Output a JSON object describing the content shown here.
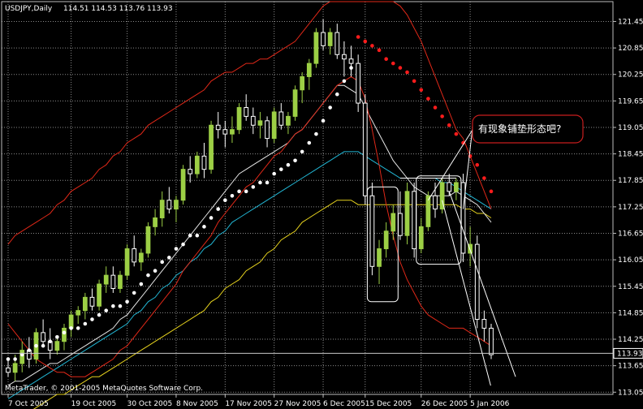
{
  "chart_data": {
    "type": "candlestick",
    "header": "USDJPY,Daily",
    "ohlc_text": "114.51 114.53 113.76 113.93",
    "current_price_label": "113.93",
    "copyright": "MetaTrader, © 2001-2005 MetaQuotes Software Corp.",
    "annotation": "有现象铺垫形态吧?",
    "ylim": [
      113.0,
      121.9
    ],
    "y_ticks": [
      "121.45",
      "120.85",
      "120.25",
      "119.65",
      "119.05",
      "118.45",
      "117.85",
      "117.25",
      "116.65",
      "116.05",
      "115.45",
      "114.85",
      "114.25",
      "113.65",
      "113.05"
    ],
    "x_ticks": [
      "7 Oct 2005",
      "19 Oct 2005",
      "30 Oct 2005",
      "8 Nov 2005",
      "17 Nov 2005",
      "27 Nov 2005",
      "6 Dec 2005",
      "15 Dec 2005",
      "26 Dec 2005",
      "5 Jan 2006"
    ],
    "grid": true,
    "colors": {
      "background": "#000000",
      "grid": "#8a8a8a",
      "bull": "#9ccf45",
      "bear": "#ffffff",
      "bollinger": "#e02818",
      "ma_fast": "#e6e6e6",
      "ma_mid": "#22b6d4",
      "ma_slow": "#e6d21e",
      "psar_up": "#ffffff",
      "psar_down": "#ff1c1c",
      "current_line": "#c8c8c8"
    },
    "candles": [
      [
        113.6,
        113.8,
        113.4,
        113.5
      ],
      [
        113.5,
        113.9,
        113.3,
        113.7
      ],
      [
        113.7,
        114.2,
        113.5,
        114.0
      ],
      [
        114.0,
        114.3,
        113.6,
        113.8
      ],
      [
        113.8,
        114.5,
        113.7,
        114.4
      ],
      [
        114.4,
        114.7,
        114.1,
        114.2
      ],
      [
        114.2,
        114.5,
        113.8,
        114.0
      ],
      [
        114.0,
        114.3,
        113.9,
        114.2
      ],
      [
        114.2,
        114.6,
        114.0,
        114.5
      ],
      [
        114.5,
        114.9,
        114.3,
        114.8
      ],
      [
        114.8,
        115.0,
        114.6,
        114.9
      ],
      [
        114.9,
        115.3,
        114.7,
        115.2
      ],
      [
        115.2,
        115.4,
        114.9,
        115.0
      ],
      [
        115.0,
        115.6,
        114.9,
        115.5
      ],
      [
        115.5,
        115.9,
        115.3,
        115.7
      ],
      [
        115.7,
        115.9,
        115.3,
        115.4
      ],
      [
        115.4,
        115.8,
        115.3,
        115.7
      ],
      [
        115.7,
        116.4,
        115.6,
        116.3
      ],
      [
        116.3,
        116.6,
        115.9,
        116.0
      ],
      [
        116.0,
        116.3,
        115.8,
        116.2
      ],
      [
        116.2,
        116.9,
        116.1,
        116.8
      ],
      [
        116.8,
        117.2,
        116.6,
        117.0
      ],
      [
        117.0,
        117.6,
        116.8,
        117.4
      ],
      [
        117.4,
        117.7,
        117.1,
        117.2
      ],
      [
        117.2,
        117.5,
        116.9,
        117.4
      ],
      [
        117.4,
        118.2,
        117.3,
        118.1
      ],
      [
        118.1,
        118.4,
        117.8,
        118.0
      ],
      [
        118.0,
        118.5,
        117.9,
        118.4
      ],
      [
        118.4,
        118.7,
        117.9,
        118.1
      ],
      [
        118.1,
        119.2,
        118.0,
        119.1
      ],
      [
        119.1,
        119.4,
        118.8,
        119.0
      ],
      [
        119.0,
        119.2,
        118.6,
        118.9
      ],
      [
        118.9,
        119.3,
        118.7,
        119.0
      ],
      [
        119.0,
        119.6,
        118.9,
        119.5
      ],
      [
        119.5,
        119.8,
        119.2,
        119.3
      ],
      [
        119.3,
        119.5,
        118.9,
        119.1
      ],
      [
        119.1,
        119.4,
        118.8,
        119.2
      ],
      [
        119.2,
        119.3,
        118.6,
        118.8
      ],
      [
        118.8,
        119.5,
        118.7,
        119.4
      ],
      [
        119.4,
        119.6,
        119.0,
        119.1
      ],
      [
        119.1,
        119.4,
        118.9,
        119.3
      ],
      [
        119.3,
        120.0,
        119.2,
        119.9
      ],
      [
        119.9,
        120.3,
        119.6,
        120.2
      ],
      [
        120.2,
        120.6,
        119.9,
        120.5
      ],
      [
        120.5,
        121.3,
        120.4,
        121.2
      ],
      [
        121.2,
        121.5,
        120.8,
        120.9
      ],
      [
        120.9,
        121.3,
        120.7,
        121.2
      ],
      [
        121.2,
        121.4,
        120.6,
        120.7
      ],
      [
        120.7,
        121.0,
        120.2,
        120.6
      ],
      [
        120.6,
        120.9,
        120.2,
        120.5
      ],
      [
        120.5,
        120.7,
        119.4,
        119.6
      ],
      [
        119.6,
        119.8,
        117.3,
        117.5
      ],
      [
        117.5,
        117.8,
        115.7,
        115.9
      ],
      [
        115.9,
        116.5,
        115.5,
        116.3
      ],
      [
        116.3,
        116.9,
        116.1,
        116.7
      ],
      [
        116.7,
        117.3,
        116.5,
        117.1
      ],
      [
        117.1,
        117.6,
        116.5,
        116.6
      ],
      [
        116.6,
        117.8,
        116.4,
        117.6
      ],
      [
        117.6,
        117.8,
        116.1,
        116.3
      ],
      [
        116.3,
        117.0,
        116.2,
        116.8
      ],
      [
        116.8,
        117.6,
        116.7,
        117.5
      ],
      [
        117.5,
        117.8,
        117.0,
        117.2
      ],
      [
        117.2,
        117.9,
        117.1,
        117.8
      ],
      [
        117.8,
        118.0,
        117.5,
        117.6
      ],
      [
        117.6,
        117.9,
        117.4,
        117.8
      ],
      [
        117.8,
        118.0,
        116.0,
        116.2
      ],
      [
        116.2,
        116.8,
        115.9,
        116.4
      ],
      [
        116.4,
        116.6,
        114.5,
        114.7
      ],
      [
        114.7,
        114.9,
        114.2,
        114.5
      ],
      [
        114.5,
        114.6,
        113.8,
        113.9
      ]
    ],
    "bollinger_upper": [
      116.4,
      116.6,
      116.7,
      116.8,
      116.9,
      117.0,
      117.1,
      117.3,
      117.4,
      117.6,
      117.7,
      117.8,
      117.9,
      118.1,
      118.2,
      118.4,
      118.5,
      118.7,
      118.8,
      118.9,
      119.1,
      119.2,
      119.3,
      119.4,
      119.5,
      119.6,
      119.7,
      119.8,
      119.9,
      120.1,
      120.2,
      120.3,
      120.3,
      120.4,
      120.5,
      120.5,
      120.6,
      120.6,
      120.7,
      120.8,
      120.9,
      121.0,
      121.2,
      121.4,
      121.6,
      121.8,
      121.9,
      121.9,
      121.9,
      121.9,
      121.9,
      121.9,
      121.9,
      121.9,
      121.9,
      121.9,
      121.8,
      121.6,
      121.3,
      121.0,
      120.6,
      120.2,
      119.8,
      119.4,
      119.0,
      118.8,
      118.4,
      118.0,
      117.6,
      117.2
    ],
    "bollinger_lower": [
      114.6,
      114.4,
      114.2,
      114.0,
      113.8,
      113.7,
      113.6,
      113.5,
      113.5,
      113.4,
      113.4,
      113.4,
      113.5,
      113.6,
      113.7,
      113.8,
      114.0,
      114.1,
      114.3,
      114.5,
      114.7,
      114.9,
      115.1,
      115.3,
      115.5,
      115.8,
      116.0,
      116.2,
      116.4,
      116.6,
      116.9,
      117.1,
      117.3,
      117.5,
      117.7,
      117.8,
      118.0,
      118.2,
      118.4,
      118.5,
      118.7,
      118.9,
      119.0,
      119.2,
      119.4,
      119.6,
      119.8,
      120.0,
      120.1,
      120.2,
      120.1,
      119.7,
      119.0,
      118.2,
      117.3,
      116.6,
      116.0,
      115.6,
      115.3,
      115.0,
      114.8,
      114.7,
      114.6,
      114.5,
      114.5,
      114.5,
      114.4,
      114.3,
      114.2,
      114.1
    ],
    "ma_fast": [
      113.2,
      113.3,
      113.3,
      113.4,
      113.5,
      113.6,
      113.7,
      113.7,
      113.8,
      113.9,
      114.0,
      114.1,
      114.2,
      114.3,
      114.4,
      114.5,
      114.7,
      114.8,
      115.0,
      115.2,
      115.4,
      115.6,
      115.8,
      116.0,
      116.2,
      116.4,
      116.6,
      116.8,
      117.0,
      117.2,
      117.4,
      117.6,
      117.8,
      118.0,
      118.1,
      118.2,
      118.3,
      118.4,
      118.5,
      118.6,
      118.7,
      118.9,
      119.0,
      119.2,
      119.4,
      119.6,
      119.8,
      120.0,
      120.0,
      119.9,
      119.8,
      119.5,
      119.2,
      118.9,
      118.6,
      118.3,
      118.1,
      117.9,
      117.7,
      117.6,
      117.5,
      117.5,
      117.5,
      117.5,
      117.6,
      117.5,
      117.4,
      117.3,
      117.1,
      116.9
    ],
    "ma_mid": [
      112.9,
      113.0,
      113.1,
      113.2,
      113.3,
      113.4,
      113.5,
      113.6,
      113.7,
      113.8,
      113.9,
      114.0,
      114.1,
      114.2,
      114.3,
      114.4,
      114.5,
      114.6,
      114.8,
      114.9,
      115.1,
      115.2,
      115.4,
      115.5,
      115.7,
      115.8,
      116.0,
      116.1,
      116.3,
      116.4,
      116.6,
      116.7,
      116.9,
      117.0,
      117.1,
      117.2,
      117.3,
      117.4,
      117.5,
      117.6,
      117.7,
      117.8,
      117.9,
      118.0,
      118.1,
      118.2,
      118.3,
      118.4,
      118.5,
      118.5,
      118.5,
      118.4,
      118.3,
      118.2,
      118.1,
      118.0,
      117.9,
      117.9,
      117.9,
      117.9,
      117.9,
      117.9,
      117.8,
      117.8,
      117.7,
      117.6,
      117.5,
      117.4,
      117.3,
      117.2
    ],
    "ma_slow": [
      112.4,
      112.5,
      112.6,
      112.6,
      112.7,
      112.8,
      112.9,
      113.0,
      113.0,
      113.1,
      113.2,
      113.3,
      113.4,
      113.4,
      113.5,
      113.6,
      113.7,
      113.8,
      113.9,
      114.0,
      114.1,
      114.2,
      114.3,
      114.4,
      114.5,
      114.6,
      114.7,
      114.8,
      114.9,
      115.1,
      115.2,
      115.4,
      115.5,
      115.6,
      115.8,
      115.9,
      116.0,
      116.2,
      116.3,
      116.5,
      116.6,
      116.7,
      116.9,
      117.0,
      117.1,
      117.2,
      117.3,
      117.4,
      117.4,
      117.4,
      117.3,
      117.3,
      117.3,
      117.3,
      117.3,
      117.3,
      117.3,
      117.3,
      117.3,
      117.3,
      117.3,
      117.3,
      117.3,
      117.3,
      117.3,
      117.2,
      117.2,
      117.1,
      117.1,
      117.0
    ],
    "psar": [
      113.8,
      113.8,
      113.9,
      114.0,
      114.1,
      114.1,
      114.2,
      114.3,
      114.4,
      114.5,
      114.5,
      114.6,
      114.7,
      114.8,
      114.9,
      115.0,
      115.0,
      115.1,
      115.3,
      115.5,
      115.7,
      115.8,
      116.0,
      116.1,
      116.3,
      116.4,
      116.6,
      116.6,
      116.8,
      117.0,
      117.2,
      117.4,
      117.5,
      117.6,
      117.6,
      117.7,
      117.8,
      117.8,
      118.0,
      118.1,
      118.2,
      118.3,
      118.5,
      118.7,
      118.9,
      119.2,
      119.5,
      119.8,
      120.1,
      120.4,
      121.1,
      121.0,
      120.9,
      120.8,
      120.6,
      120.5,
      120.4,
      120.3,
      120.1,
      119.9,
      119.7,
      119.5,
      119.3,
      119.1,
      118.9,
      118.7,
      118.4,
      118.2,
      117.9,
      117.6
    ],
    "psar_dir": [
      "up",
      "up",
      "up",
      "up",
      "up",
      "up",
      "up",
      "up",
      "up",
      "up",
      "up",
      "up",
      "up",
      "up",
      "up",
      "up",
      "up",
      "up",
      "up",
      "up",
      "up",
      "up",
      "up",
      "up",
      "up",
      "up",
      "up",
      "up",
      "up",
      "up",
      "up",
      "up",
      "up",
      "up",
      "up",
      "up",
      "up",
      "up",
      "up",
      "up",
      "up",
      "up",
      "up",
      "up",
      "up",
      "up",
      "up",
      "up",
      "up",
      "up",
      "down",
      "down",
      "down",
      "down",
      "down",
      "down",
      "down",
      "down",
      "down",
      "down",
      "down",
      "down",
      "down",
      "down",
      "down",
      "down",
      "down",
      "down",
      "down",
      "down"
    ]
  }
}
